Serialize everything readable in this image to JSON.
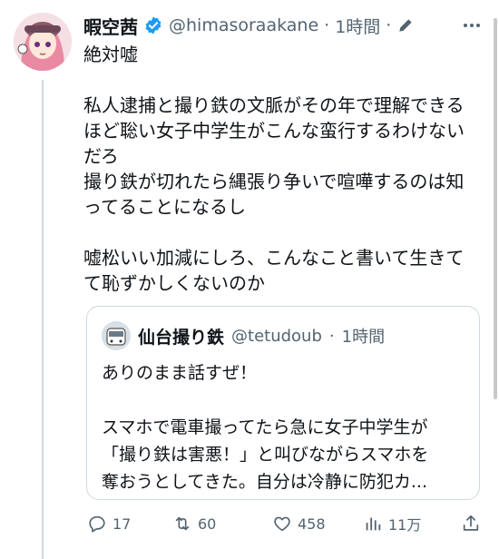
{
  "tweet": {
    "author": {
      "name": "暇空茜",
      "handle": "@himasoraakane",
      "verified": true,
      "time": "1時間"
    },
    "separator": "·",
    "body": [
      "絶対嘘",
      "",
      "私人逮捕と撮り鉄の文脈がその年で理解できる",
      "ほど聡い女子中学生がこんな蛮行するわけない",
      "だろ",
      "撮り鉄が切れたら縄張り争いで喧嘩するのは知",
      "ってることになるし",
      "",
      "嘘松いい加減にしろ、こんなこと書いて生きて",
      "て恥ずかしくないのか"
    ],
    "quoted": {
      "name": "仙台撮り鉄",
      "handle": "@tetudoub",
      "time": "1時間",
      "body": [
        "ありのまま話すぜ！",
        "",
        "スマホで電車撮ってたら急に女子中学生が",
        "「撮り鉄は害悪！」と叫びながらスマホを",
        "奪おうとしてきた。自分は冷静に防犯カ..."
      ]
    },
    "actions": {
      "replies": "17",
      "retweets": "60",
      "likes": "458",
      "views": "11万"
    }
  },
  "colors": {
    "text": "#0f1419",
    "secondary": "#536471",
    "border": "#cfd9de",
    "verified": "#1d9bf0"
  }
}
